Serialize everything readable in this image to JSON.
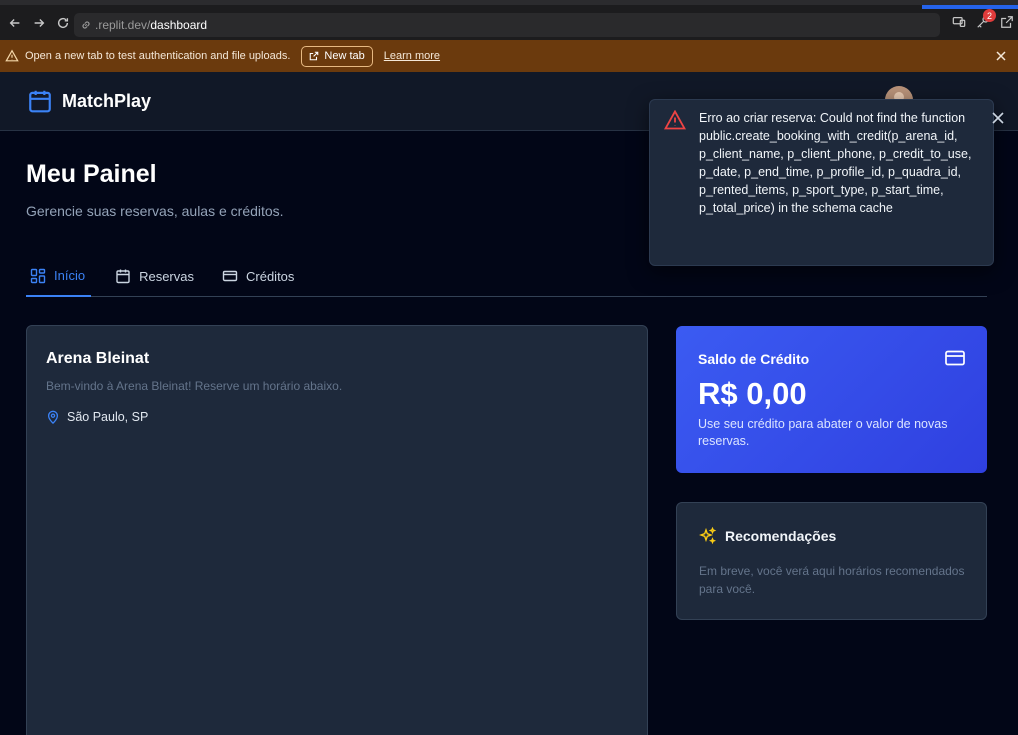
{
  "browser": {
    "url_host": ".replit.dev/",
    "url_path": "dashboard",
    "notification_count": "2"
  },
  "banner": {
    "message": "Open a new tab to test authentication and file uploads.",
    "new_tab_label": "New tab",
    "learn_more_label": "Learn more"
  },
  "header": {
    "app_name": "MatchPlay"
  },
  "page": {
    "title": "Meu Painel",
    "subtitle": "Gerencie suas reservas, aulas e créditos."
  },
  "tabs": [
    {
      "label": "Início",
      "icon": "layout-grid-icon",
      "active": true
    },
    {
      "label": "Reservas",
      "icon": "calendar-icon",
      "active": false
    },
    {
      "label": "Créditos",
      "icon": "credit-card-icon",
      "active": false
    }
  ],
  "arena": {
    "name": "Arena Bleinat",
    "welcome": "Bem-vindo à Arena Bleinat! Reserve um horário abaixo.",
    "location": "São Paulo, SP"
  },
  "credit": {
    "label": "Saldo de Crédito",
    "amount": "R$ 0,00",
    "description": "Use seu crédito para abater o valor de novas reservas."
  },
  "recommendations": {
    "title": "Recomendações",
    "description": "Em breve, você verá aqui horários recomendados para você."
  },
  "toast": {
    "message": "Erro ao criar reserva: Could not find the function public.create_booking_with_credit(p_arena_id, p_client_name, p_client_phone, p_credit_to_use, p_date, p_end_time, p_profile_id, p_quadra_id, p_rented_items, p_sport_type, p_start_time, p_total_price) in the schema cache"
  },
  "colors": {
    "accent": "#3b82f6",
    "credit_card": "#3b5bf2",
    "error": "#ef4444",
    "banner": "#6b3a0d"
  }
}
